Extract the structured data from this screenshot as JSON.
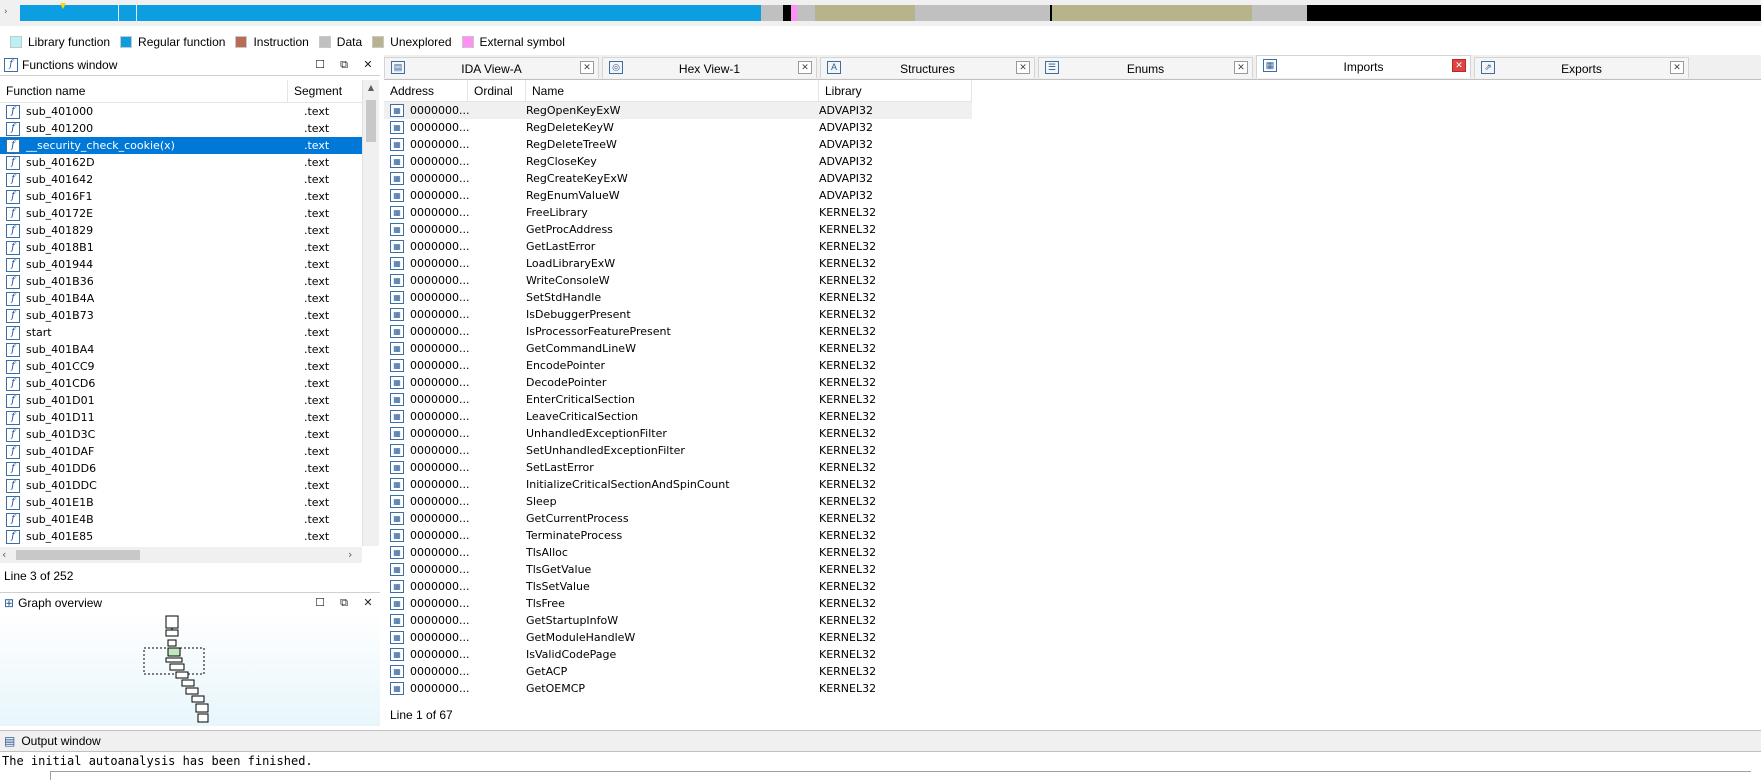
{
  "legend": [
    {
      "label": "Library function",
      "color": "#b8f2f2"
    },
    {
      "label": "Regular function",
      "color": "#0b9ee0"
    },
    {
      "label": "Instruction",
      "color": "#b86b55"
    },
    {
      "label": "Data",
      "color": "#c0c0c0"
    },
    {
      "label": "Unexplored",
      "color": "#b7b48b"
    },
    {
      "label": "External symbol",
      "color": "#ff8ff2"
    }
  ],
  "functions_window": {
    "title": "Functions window",
    "col_name": "Function name",
    "col_segment": "Segment",
    "rows": [
      {
        "name": "sub_401000",
        "segment": ".text"
      },
      {
        "name": "sub_401200",
        "segment": ".text"
      },
      {
        "name": "__security_check_cookie(x)",
        "segment": ".text",
        "selected": true
      },
      {
        "name": "sub_40162D",
        "segment": ".text"
      },
      {
        "name": "sub_401642",
        "segment": ".text"
      },
      {
        "name": "sub_4016F1",
        "segment": ".text"
      },
      {
        "name": "sub_40172E",
        "segment": ".text"
      },
      {
        "name": "sub_401829",
        "segment": ".text"
      },
      {
        "name": "sub_4018B1",
        "segment": ".text"
      },
      {
        "name": "sub_401944",
        "segment": ".text"
      },
      {
        "name": "sub_401B36",
        "segment": ".text"
      },
      {
        "name": "sub_401B4A",
        "segment": ".text"
      },
      {
        "name": "sub_401B73",
        "segment": ".text"
      },
      {
        "name": "start",
        "segment": ".text"
      },
      {
        "name": "sub_401BA4",
        "segment": ".text"
      },
      {
        "name": "sub_401CC9",
        "segment": ".text"
      },
      {
        "name": "sub_401CD6",
        "segment": ".text"
      },
      {
        "name": "sub_401D01",
        "segment": ".text"
      },
      {
        "name": "sub_401D11",
        "segment": ".text"
      },
      {
        "name": "sub_401D3C",
        "segment": ".text"
      },
      {
        "name": "sub_401DAF",
        "segment": ".text"
      },
      {
        "name": "sub_401DD6",
        "segment": ".text"
      },
      {
        "name": "sub_401DDC",
        "segment": ".text"
      },
      {
        "name": "sub_401E1B",
        "segment": ".text"
      },
      {
        "name": "sub_401E4B",
        "segment": ".text"
      },
      {
        "name": "sub_401E85",
        "segment": ".text"
      }
    ],
    "status": "Line 3 of 252"
  },
  "graph_overview": {
    "title": "Graph overview"
  },
  "tabs": [
    {
      "label": "IDA View-A",
      "icon": "ida-view-icon",
      "glyph": "▤",
      "active": false
    },
    {
      "label": "Hex View-1",
      "icon": "hex-view-icon",
      "glyph": "◎",
      "active": false
    },
    {
      "label": "Structures",
      "icon": "structures-icon",
      "glyph": "A",
      "active": false
    },
    {
      "label": "Enums",
      "icon": "enums-icon",
      "glyph": "☰",
      "active": false
    },
    {
      "label": "Imports",
      "icon": "imports-icon",
      "glyph": "▦",
      "active": true
    },
    {
      "label": "Exports",
      "icon": "exports-icon",
      "glyph": "⇗",
      "active": false
    }
  ],
  "imports": {
    "columns": {
      "address": "Address",
      "ordinal": "Ordinal",
      "name": "Name",
      "library": "Library"
    },
    "rows": [
      {
        "address": "0000000...",
        "ordinal": "",
        "name": "RegOpenKeyExW",
        "library": "ADVAPI32"
      },
      {
        "address": "0000000...",
        "ordinal": "",
        "name": "RegDeleteKeyW",
        "library": "ADVAPI32"
      },
      {
        "address": "0000000...",
        "ordinal": "",
        "name": "RegDeleteTreeW",
        "library": "ADVAPI32"
      },
      {
        "address": "0000000...",
        "ordinal": "",
        "name": "RegCloseKey",
        "library": "ADVAPI32"
      },
      {
        "address": "0000000...",
        "ordinal": "",
        "name": "RegCreateKeyExW",
        "library": "ADVAPI32"
      },
      {
        "address": "0000000...",
        "ordinal": "",
        "name": "RegEnumValueW",
        "library": "ADVAPI32"
      },
      {
        "address": "0000000...",
        "ordinal": "",
        "name": "FreeLibrary",
        "library": "KERNEL32"
      },
      {
        "address": "0000000...",
        "ordinal": "",
        "name": "GetProcAddress",
        "library": "KERNEL32"
      },
      {
        "address": "0000000...",
        "ordinal": "",
        "name": "GetLastError",
        "library": "KERNEL32"
      },
      {
        "address": "0000000...",
        "ordinal": "",
        "name": "LoadLibraryExW",
        "library": "KERNEL32"
      },
      {
        "address": "0000000...",
        "ordinal": "",
        "name": "WriteConsoleW",
        "library": "KERNEL32"
      },
      {
        "address": "0000000...",
        "ordinal": "",
        "name": "SetStdHandle",
        "library": "KERNEL32"
      },
      {
        "address": "0000000...",
        "ordinal": "",
        "name": "IsDebuggerPresent",
        "library": "KERNEL32"
      },
      {
        "address": "0000000...",
        "ordinal": "",
        "name": "IsProcessorFeaturePresent",
        "library": "KERNEL32"
      },
      {
        "address": "0000000...",
        "ordinal": "",
        "name": "GetCommandLineW",
        "library": "KERNEL32"
      },
      {
        "address": "0000000...",
        "ordinal": "",
        "name": "EncodePointer",
        "library": "KERNEL32"
      },
      {
        "address": "0000000...",
        "ordinal": "",
        "name": "DecodePointer",
        "library": "KERNEL32"
      },
      {
        "address": "0000000...",
        "ordinal": "",
        "name": "EnterCriticalSection",
        "library": "KERNEL32"
      },
      {
        "address": "0000000...",
        "ordinal": "",
        "name": "LeaveCriticalSection",
        "library": "KERNEL32"
      },
      {
        "address": "0000000...",
        "ordinal": "",
        "name": "UnhandledExceptionFilter",
        "library": "KERNEL32"
      },
      {
        "address": "0000000...",
        "ordinal": "",
        "name": "SetUnhandledExceptionFilter",
        "library": "KERNEL32"
      },
      {
        "address": "0000000...",
        "ordinal": "",
        "name": "SetLastError",
        "library": "KERNEL32"
      },
      {
        "address": "0000000...",
        "ordinal": "",
        "name": "InitializeCriticalSectionAndSpinCount",
        "library": "KERNEL32"
      },
      {
        "address": "0000000...",
        "ordinal": "",
        "name": "Sleep",
        "library": "KERNEL32"
      },
      {
        "address": "0000000...",
        "ordinal": "",
        "name": "GetCurrentProcess",
        "library": "KERNEL32"
      },
      {
        "address": "0000000...",
        "ordinal": "",
        "name": "TerminateProcess",
        "library": "KERNEL32"
      },
      {
        "address": "0000000...",
        "ordinal": "",
        "name": "TlsAlloc",
        "library": "KERNEL32"
      },
      {
        "address": "0000000...",
        "ordinal": "",
        "name": "TlsGetValue",
        "library": "KERNEL32"
      },
      {
        "address": "0000000...",
        "ordinal": "",
        "name": "TlsSetValue",
        "library": "KERNEL32"
      },
      {
        "address": "0000000...",
        "ordinal": "",
        "name": "TlsFree",
        "library": "KERNEL32"
      },
      {
        "address": "0000000...",
        "ordinal": "",
        "name": "GetStartupInfoW",
        "library": "KERNEL32"
      },
      {
        "address": "0000000...",
        "ordinal": "",
        "name": "GetModuleHandleW",
        "library": "KERNEL32"
      },
      {
        "address": "0000000...",
        "ordinal": "",
        "name": "IsValidCodePage",
        "library": "KERNEL32"
      },
      {
        "address": "0000000...",
        "ordinal": "",
        "name": "GetACP",
        "library": "KERNEL32"
      },
      {
        "address": "0000000...",
        "ordinal": "",
        "name": "GetOEMCP",
        "library": "KERNEL32"
      }
    ],
    "status": "Line 1 of 67"
  },
  "output_window": {
    "title": "Output window",
    "text": "The initial autoanalysis has been finished."
  }
}
